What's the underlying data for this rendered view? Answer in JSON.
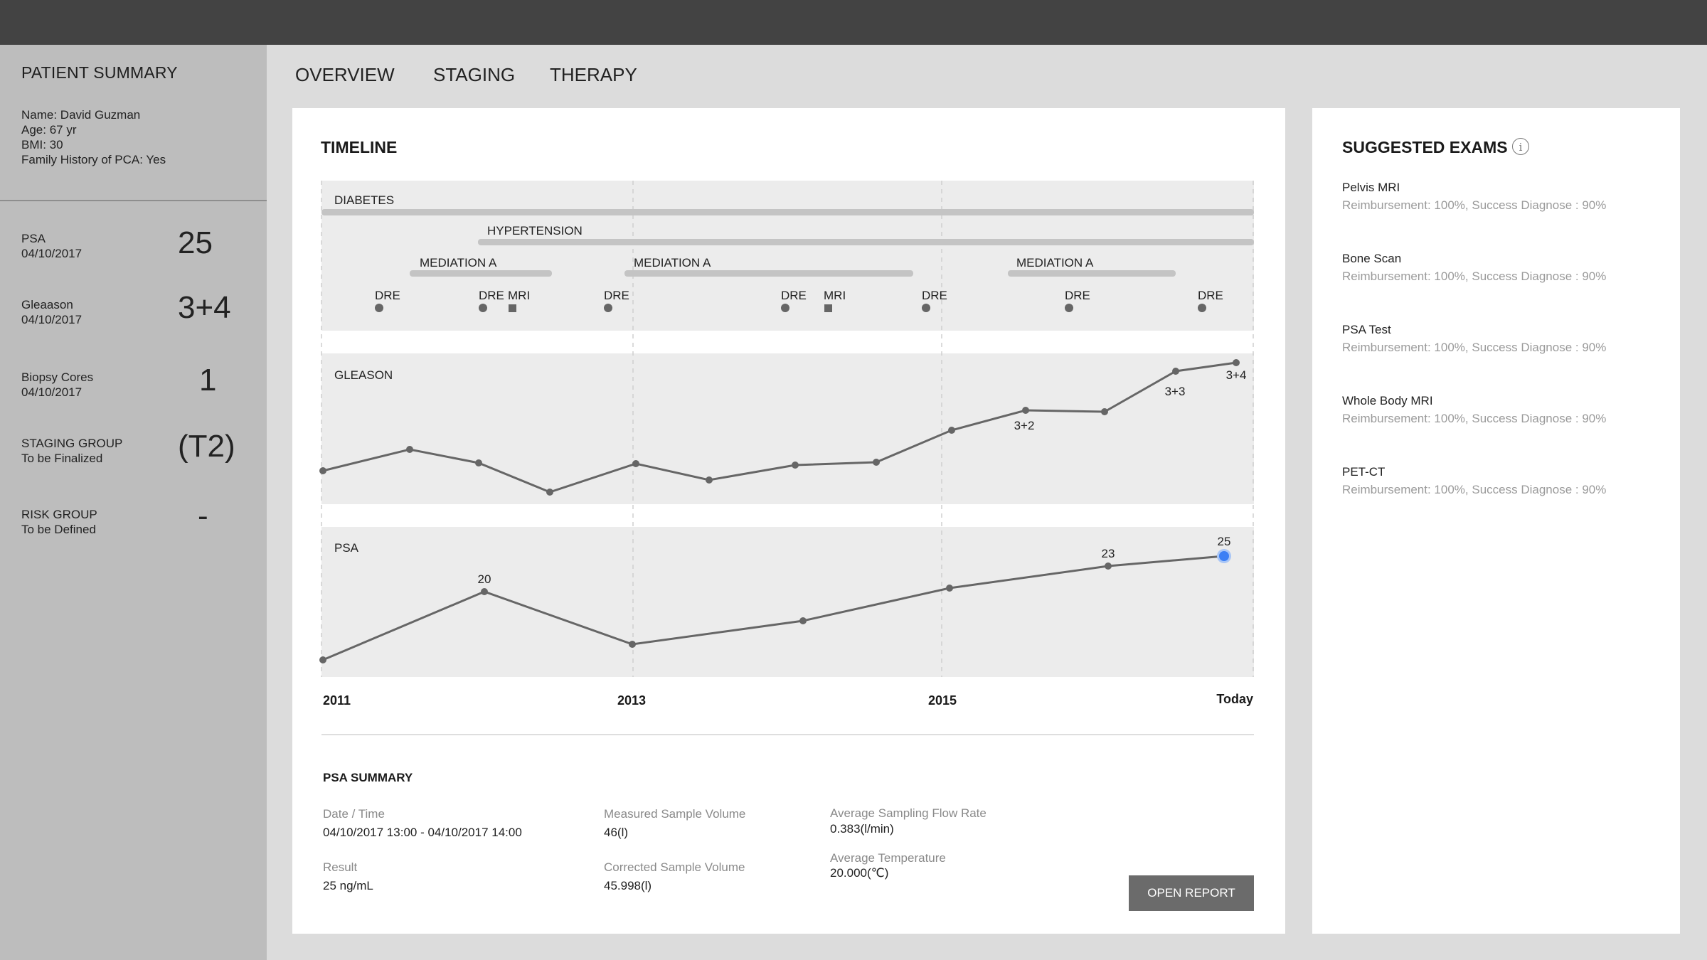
{
  "sidebar": {
    "title": "PATIENT SUMMARY",
    "patient": {
      "name": "Name: David Guzman",
      "age": "Age: 67 yr",
      "bmi": "BMI: 30",
      "family_history": "Family History of PCA: Yes"
    },
    "metrics": [
      {
        "label": "PSA",
        "sub": "04/10/2017",
        "value": "25"
      },
      {
        "label": "Gleaason",
        "sub": "04/10/2017",
        "value": "3+4"
      },
      {
        "label": "Biopsy Cores",
        "sub": "04/10/2017",
        "value": "1"
      },
      {
        "label": "STAGING GROUP",
        "sub": "To be Finalized",
        "value": "(T2)"
      },
      {
        "label": "RISK GROUP",
        "sub": "To be Defined",
        "value": "-"
      }
    ]
  },
  "tabs": [
    "OVERVIEW",
    "STAGING",
    "THERAPY"
  ],
  "timeline": {
    "title": "TIMELINE",
    "x_labels": [
      "2011",
      "2013",
      "2015",
      "Today"
    ],
    "conditions": [
      "DIABETES",
      "HYPERTENSION"
    ],
    "mediation_label": "MEDIATION A",
    "events": [
      {
        "label": "DRE",
        "type": "dot"
      },
      {
        "label": "DRE",
        "type": "dot"
      },
      {
        "label": "MRI",
        "type": "square"
      },
      {
        "label": "DRE",
        "type": "dot"
      },
      {
        "label": "DRE",
        "type": "dot"
      },
      {
        "label": "MRI",
        "type": "square"
      },
      {
        "label": "DRE",
        "type": "dot"
      },
      {
        "label": "DRE",
        "type": "dot"
      },
      {
        "label": "DRE",
        "type": "dot"
      }
    ],
    "gleason": {
      "label": "GLEASON",
      "annotations": [
        "3+2",
        "3+3",
        "3+4"
      ]
    },
    "psa": {
      "label": "PSA",
      "annotations": [
        "20",
        "23",
        "25"
      ]
    }
  },
  "psa_summary": {
    "title": "PSA SUMMARY",
    "date_label": "Date / Time",
    "date_value": "04/10/2017 13:00 - 04/10/2017 14:00",
    "result_label": "Result",
    "result_value": "25 ng/mL",
    "measured_label": "Measured Sample Volume",
    "measured_value": "46(l)",
    "corrected_label": "Corrected Sample Volume",
    "corrected_value": "45.998(l)",
    "flow_label": "Average Sampling Flow Rate",
    "flow_value": "0.383(l/min)",
    "temp_label": "Average Temperature",
    "temp_value": "20.000(℃)",
    "open_report": "OPEN REPORT"
  },
  "suggested": {
    "title": "SUGGESTED EXAMS",
    "info_icon": "i",
    "exams": [
      {
        "name": "Pelvis MRI",
        "meta": "Reimbursement: 100%, Success Diagnose : 90%"
      },
      {
        "name": "Bone Scan",
        "meta": "Reimbursement: 100%, Success Diagnose : 90%"
      },
      {
        "name": "PSA Test",
        "meta": "Reimbursement: 100%, Success Diagnose : 90%"
      },
      {
        "name": "Whole Body MRI",
        "meta": "Reimbursement: 100%, Success Diagnose : 90%"
      },
      {
        "name": "PET-CT",
        "meta": "Reimbursement: 100%, Success Diagnose : 90%"
      }
    ]
  },
  "colors": {
    "accent": "#3b7ff5",
    "line": "#666666",
    "band": "#ececec",
    "bar": "#c4c4c4"
  }
}
